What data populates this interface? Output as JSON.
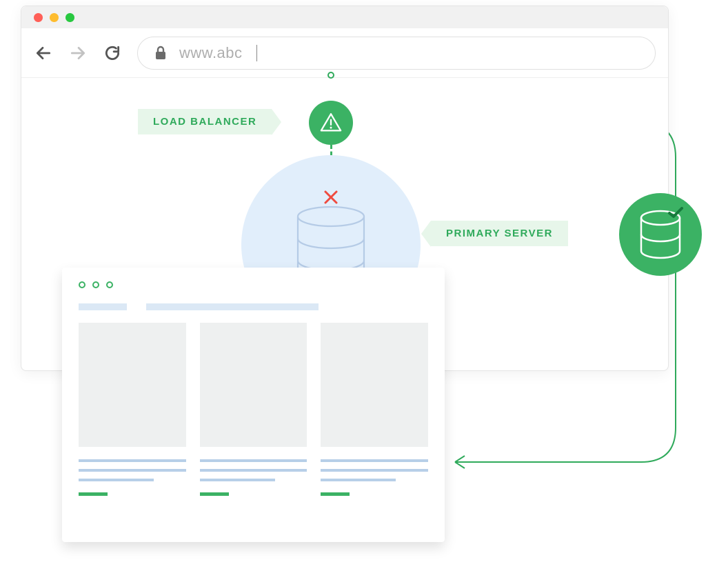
{
  "browser": {
    "url_text": "www.abc"
  },
  "labels": {
    "load_balancer": "LOAD BALANCER",
    "primary_server": "PRIMARY SERVER"
  },
  "diagram": {
    "primary_status": "failed",
    "secondary_status": "ok"
  },
  "colors": {
    "green": "#3bb264",
    "green_light": "#e7f6ea",
    "blue_light": "#e1eefb",
    "red": "#ef4a3f"
  }
}
